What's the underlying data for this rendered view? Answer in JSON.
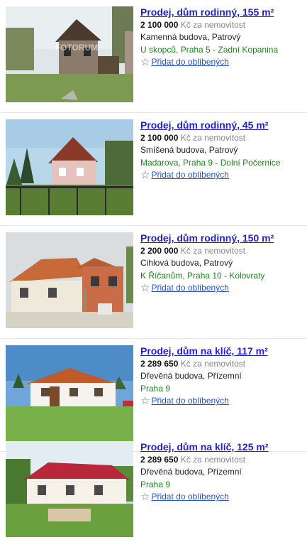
{
  "listings": [
    {
      "title": "Prodej, dům rodinný, 155 m²",
      "price": "2 100 000",
      "price_suffix": " Kč za nemovitost",
      "building": "Kamenná budova, Patrový",
      "address": "U skopců, Praha 5 - Zadní Kopanina",
      "favorite_label": "Přidat do oblíbených",
      "watermark": "FOTORUM"
    },
    {
      "title": "Prodej, dům rodinný, 45 m²",
      "price": "2 100 000",
      "price_suffix": " Kč za nemovitost",
      "building": "Smíšená budova, Patrový",
      "address": "Madarova, Praha 9 - Dolní Počernice",
      "favorite_label": "Přidat do oblíbených"
    },
    {
      "title": "Prodej, dům rodinný, 150 m²",
      "price": "2 200 000",
      "price_suffix": " Kč za nemovitost",
      "building": "Cihlová budova, Patrový",
      "address": "K Říčanům, Praha 10 - Kolovraty",
      "favorite_label": "Přidat do oblíbených"
    },
    {
      "title": "Prodej, dům na klíč, 117 m²",
      "price": "2 289 650",
      "price_suffix": " Kč za nemovitost",
      "building": "Dřevěná budova, Přízemní",
      "address": "Praha 9",
      "favorite_label": "Přidat do oblíbených"
    },
    {
      "title": "Prodej, dům na klíč, 125 m²",
      "price": "2 289 650",
      "price_suffix": " Kč za nemovitost",
      "building": "Dřevěná budova, Přízemní",
      "address": "Praha 9",
      "favorite_label": "Přidat do oblíbených"
    }
  ],
  "colors": {
    "title_link": "#2222cc",
    "address": "#1a8a1a",
    "favorite_link": "#2255cc",
    "price_muted": "#888888"
  },
  "icons": {
    "favorite": "star-outline-icon"
  }
}
